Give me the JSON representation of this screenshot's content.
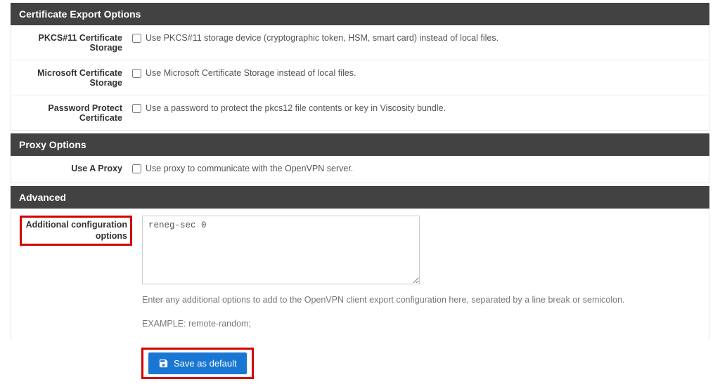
{
  "cert_export": {
    "header": "Certificate Export Options",
    "rows": [
      {
        "label": "PKCS#11 Certificate Storage",
        "desc": "Use PKCS#11 storage device (cryptographic token, HSM, smart card) instead of local files."
      },
      {
        "label": "Microsoft Certificate Storage",
        "desc": "Use Microsoft Certificate Storage instead of local files."
      },
      {
        "label": "Password Protect Certificate",
        "desc": "Use a password to protect the pkcs12 file contents or key in Viscosity bundle."
      }
    ]
  },
  "proxy": {
    "header": "Proxy Options",
    "row": {
      "label": "Use A Proxy",
      "desc": "Use proxy to communicate with the OpenVPN server."
    }
  },
  "advanced": {
    "header": "Advanced",
    "config_label": "Additional configuration options",
    "config_value": "reneg-sec 0",
    "help1": "Enter any additional options to add to the OpenVPN client export configuration here, separated by a line break or semicolon.",
    "help2": "EXAMPLE: remote-random;"
  },
  "button": {
    "save_label": "Save as default"
  }
}
